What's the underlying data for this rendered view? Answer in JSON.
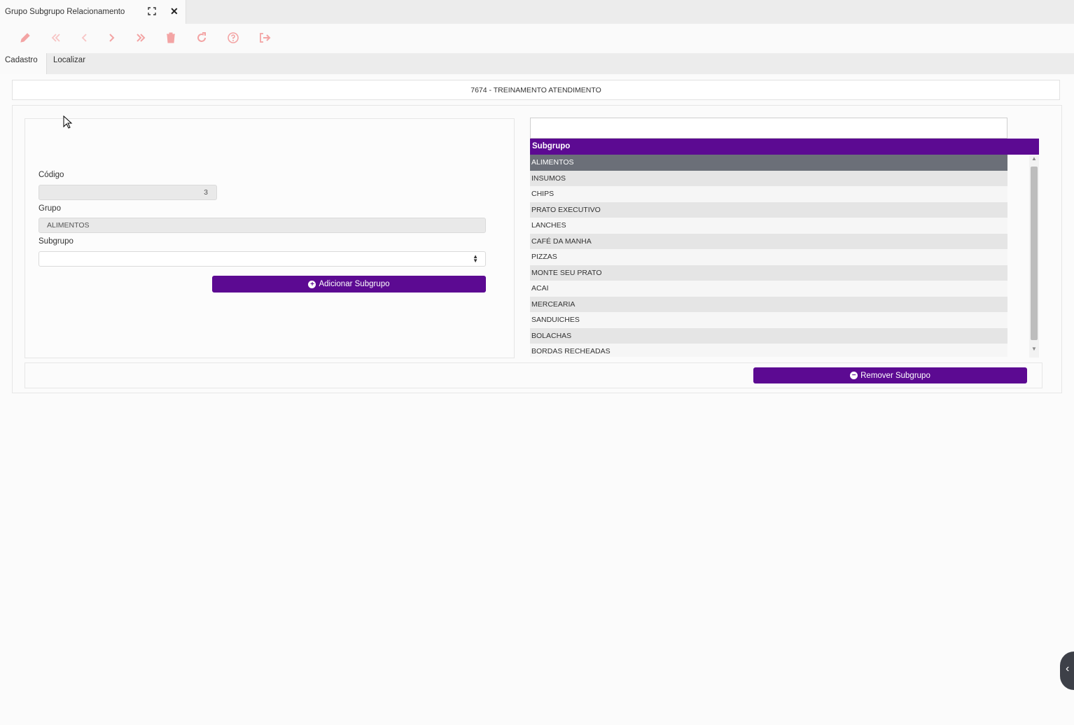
{
  "window": {
    "title": "Grupo Subgrupo Relacionamento",
    "maximize_icon": "maximize-icon",
    "close_glyph": "✕"
  },
  "toolbar": {
    "icons": [
      "pencil-icon",
      "first-page-icon",
      "previous-icon",
      "next-icon",
      "last-page-icon",
      "trash-icon",
      "refresh-icon",
      "help-icon",
      "exit-icon"
    ],
    "icon_color": "#f3a4a4"
  },
  "tabs": {
    "cadastro": "Cadastro",
    "localizar": "Localizar"
  },
  "company": "7674 - TREINAMENTO ATENDIMENTO",
  "form": {
    "codigo_label": "Código",
    "codigo_value": "3",
    "grupo_label": "Grupo",
    "grupo_value": "ALIMENTOS",
    "subgrupo_label": "Subgrupo",
    "subgrupo_value": "",
    "add_button": "Adicionar Subgrupo"
  },
  "list": {
    "search_value": "",
    "header": "Subgrupo",
    "rows": [
      "ALIMENTOS",
      "INSUMOS",
      "CHIPS",
      "PRATO EXECUTIVO",
      "LANCHES",
      "CAFÉ DA MANHA",
      "PIZZAS",
      "MONTE SEU PRATO",
      "ACAI",
      "MERCEARIA",
      "SANDUICHES",
      "BOLACHAS",
      "BORDAS RECHEADAS"
    ],
    "selected_index": 0
  },
  "remove_button": "Remover Subgrupo",
  "colors": {
    "accent": "#5c0a92",
    "selected_row": "#6b6f78"
  }
}
